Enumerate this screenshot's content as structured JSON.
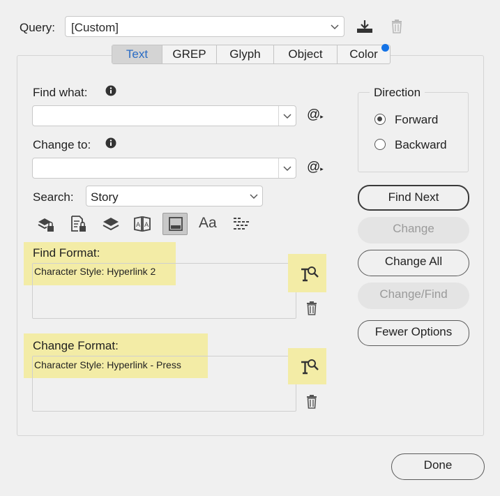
{
  "query": {
    "label": "Query:",
    "value": "[Custom]",
    "icons": [
      "save-query-icon",
      "delete-query-icon"
    ]
  },
  "tabs": [
    {
      "label": "Text",
      "active": true
    },
    {
      "label": "GREP",
      "active": false
    },
    {
      "label": "Glyph",
      "active": false
    },
    {
      "label": "Object",
      "active": false
    },
    {
      "label": "Color",
      "active": false
    }
  ],
  "colors": {
    "active_tab_text": "#2a6cc4",
    "notification_dot": "#1473e6",
    "highlight": "#f3eca6"
  },
  "find": {
    "label": "Find what:",
    "value": "",
    "special_char_icon": "@"
  },
  "change": {
    "label": "Change to:",
    "value": "",
    "special_char_icon": "@"
  },
  "search": {
    "label": "Search:",
    "value": "Story"
  },
  "toolbar_icons": [
    "include-locked-layers-icon",
    "include-locked-stories-icon",
    "include-hidden-layers-icon",
    "include-master-pages-icon",
    "include-footnotes-icon",
    "case-sensitive-icon",
    "whole-word-icon"
  ],
  "toolbar_case_label": "Aa",
  "find_format": {
    "label": "Find Format:",
    "value": "Character Style: Hyperlink 2"
  },
  "change_format": {
    "label": "Change Format:",
    "value": "Character Style: Hyperlink - Press"
  },
  "direction": {
    "title": "Direction",
    "options": [
      {
        "label": "Forward",
        "selected": true
      },
      {
        "label": "Backward",
        "selected": false
      }
    ]
  },
  "buttons": {
    "find_next": "Find Next",
    "change": "Change",
    "change_all": "Change All",
    "change_find": "Change/Find",
    "fewer_options": "Fewer Options",
    "done": "Done"
  }
}
